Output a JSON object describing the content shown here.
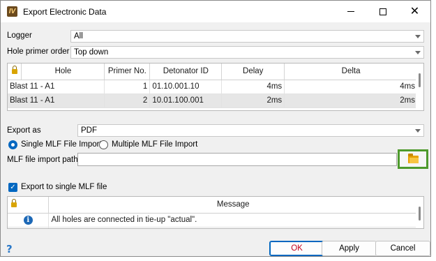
{
  "window": {
    "title": "Export Electronic Data",
    "app_icon_letter": "IV"
  },
  "logger": {
    "label": "Logger",
    "value": "All"
  },
  "hole_primer_order": {
    "label": "Hole primer order",
    "value": "Top down"
  },
  "holes_table": {
    "columns": [
      "Hole",
      "Primer No.",
      "Detonator ID",
      "Delay",
      "Delta"
    ],
    "rows": [
      {
        "hole": "Blast 11 - A1",
        "primer": "1",
        "detonator_id": "01.10.001.10",
        "delay": "4ms",
        "delta": "4ms"
      },
      {
        "hole": "Blast 11 - A1",
        "primer": "2",
        "detonator_id": "10.01.100.001",
        "delay": "2ms",
        "delta": "2ms"
      }
    ]
  },
  "export_as": {
    "label": "Export as",
    "value": "PDF"
  },
  "import_mode": {
    "single_label": "Single MLF File Import",
    "multiple_label": "Multiple MLF File Import",
    "selected": "single"
  },
  "mlf_path": {
    "label": "MLF file import path",
    "value": ""
  },
  "export_single": {
    "label": "Export to single MLF file",
    "checked": true
  },
  "messages_table": {
    "column": "Message",
    "rows": [
      {
        "icon": "info-icon",
        "text": "All holes are connected in tie-up \"actual\"."
      }
    ]
  },
  "buttons": {
    "ok": "OK",
    "apply": "Apply",
    "cancel": "Cancel"
  },
  "colors": {
    "accent": "#0067c0",
    "highlight_border": "#4e9a2d",
    "ok_text": "#c4001d"
  }
}
